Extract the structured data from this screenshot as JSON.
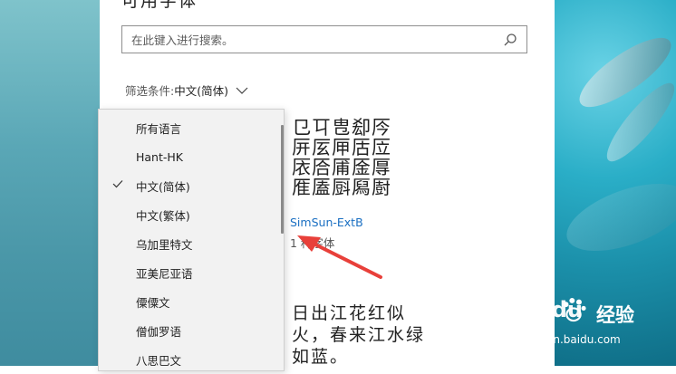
{
  "panel": {
    "title": "可用字体"
  },
  "search": {
    "placeholder": "在此键入进行搜索。",
    "icon": "search-icon"
  },
  "filter": {
    "label": "筛选条件: ",
    "value": "中文(简体)",
    "icon": "chevron-down-icon"
  },
  "dropdown": {
    "items": [
      {
        "label": "所有语言",
        "checked": false
      },
      {
        "label": "Hant-HK",
        "checked": false
      },
      {
        "label": "中文(简体)",
        "checked": true
      },
      {
        "label": "中文(繁体)",
        "checked": false
      },
      {
        "label": "乌加里特文",
        "checked": false
      },
      {
        "label": "亚美尼亚语",
        "checked": false
      },
      {
        "label": "僳僳文",
        "checked": false
      },
      {
        "label": "僧伽罗语",
        "checked": false
      },
      {
        "label": "八思巴文",
        "checked": false
      }
    ]
  },
  "font_card": {
    "preview_lines": [
      "㔾㔿㕀㕁㕂",
      "㕃㕄㕅㕆㕇",
      "㕈㕉㕊㕋㕌",
      "㕍㕎㕏㕐㕑"
    ],
    "name": "SimSun-ExtB",
    "count": "1 种字体"
  },
  "sample": {
    "text": "日出江花红似火，春来江水绿如蓝。"
  },
  "watermark": {
    "brand": "Baidu",
    "product": "经验",
    "url": "jingyan.baidu.com"
  },
  "colors": {
    "accent_link": "#1a6fc2",
    "annotation_arrow": "#e8403a"
  }
}
